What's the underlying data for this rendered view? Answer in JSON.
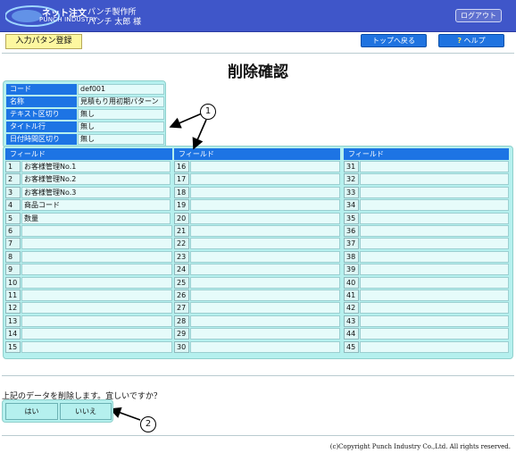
{
  "header": {
    "logo_top": "ネット注文",
    "logo_bottom": "PUNCH INDUSTRY",
    "company": "パンチ製作所",
    "user": "パンチ 太郎 様",
    "logout_label": "ログアウト"
  },
  "toolbar": {
    "pattern_button": "入力パタン登録",
    "top_button": "トップへ戻る",
    "help_icon": "?",
    "help_button": "ヘルプ"
  },
  "page_title": "削除確認",
  "info": [
    {
      "label": "コード",
      "value": "def001"
    },
    {
      "label": "名称",
      "value": "見積もり用初期パターン"
    },
    {
      "label": "テキスト区切り",
      "value": "無し"
    },
    {
      "label": "タイトル行",
      "value": "無し"
    },
    {
      "label": "日付時間区切り",
      "value": "無し"
    }
  ],
  "fields": {
    "column_header": "フィールド",
    "columns": [
      [
        {
          "num": "1",
          "name": "お客様管理No.1"
        },
        {
          "num": "2",
          "name": "お客様管理No.2"
        },
        {
          "num": "3",
          "name": "お客様管理No.3"
        },
        {
          "num": "4",
          "name": "商品コード"
        },
        {
          "num": "5",
          "name": "数量"
        },
        {
          "num": "6",
          "name": ""
        },
        {
          "num": "7",
          "name": ""
        },
        {
          "num": "8",
          "name": ""
        },
        {
          "num": "9",
          "name": ""
        },
        {
          "num": "10",
          "name": ""
        },
        {
          "num": "11",
          "name": ""
        },
        {
          "num": "12",
          "name": ""
        },
        {
          "num": "13",
          "name": ""
        },
        {
          "num": "14",
          "name": ""
        },
        {
          "num": "15",
          "name": ""
        }
      ],
      [
        {
          "num": "16",
          "name": ""
        },
        {
          "num": "17",
          "name": ""
        },
        {
          "num": "18",
          "name": ""
        },
        {
          "num": "19",
          "name": ""
        },
        {
          "num": "20",
          "name": ""
        },
        {
          "num": "21",
          "name": ""
        },
        {
          "num": "22",
          "name": ""
        },
        {
          "num": "23",
          "name": ""
        },
        {
          "num": "24",
          "name": ""
        },
        {
          "num": "25",
          "name": ""
        },
        {
          "num": "26",
          "name": ""
        },
        {
          "num": "27",
          "name": ""
        },
        {
          "num": "28",
          "name": ""
        },
        {
          "num": "29",
          "name": ""
        },
        {
          "num": "30",
          "name": ""
        }
      ],
      [
        {
          "num": "31",
          "name": ""
        },
        {
          "num": "32",
          "name": ""
        },
        {
          "num": "33",
          "name": ""
        },
        {
          "num": "34",
          "name": ""
        },
        {
          "num": "35",
          "name": ""
        },
        {
          "num": "36",
          "name": ""
        },
        {
          "num": "37",
          "name": ""
        },
        {
          "num": "38",
          "name": ""
        },
        {
          "num": "39",
          "name": ""
        },
        {
          "num": "40",
          "name": ""
        },
        {
          "num": "41",
          "name": ""
        },
        {
          "num": "42",
          "name": ""
        },
        {
          "num": "43",
          "name": ""
        },
        {
          "num": "44",
          "name": ""
        },
        {
          "num": "45",
          "name": ""
        }
      ]
    ]
  },
  "callouts": {
    "one": "1",
    "two": "2"
  },
  "confirm": {
    "message": "上記のデータを削除します。宜しいですか？",
    "yes": "はい",
    "no": "いいえ"
  },
  "footer": {
    "copyright": "(c)Copyright Punch Industry Co.,Ltd. All rights reserved."
  },
  "colors": {
    "header": "#3f56c9",
    "label_blue": "#1d74e4",
    "panel": "#b5f0ee",
    "pattern_button": "#fdf7a0"
  }
}
